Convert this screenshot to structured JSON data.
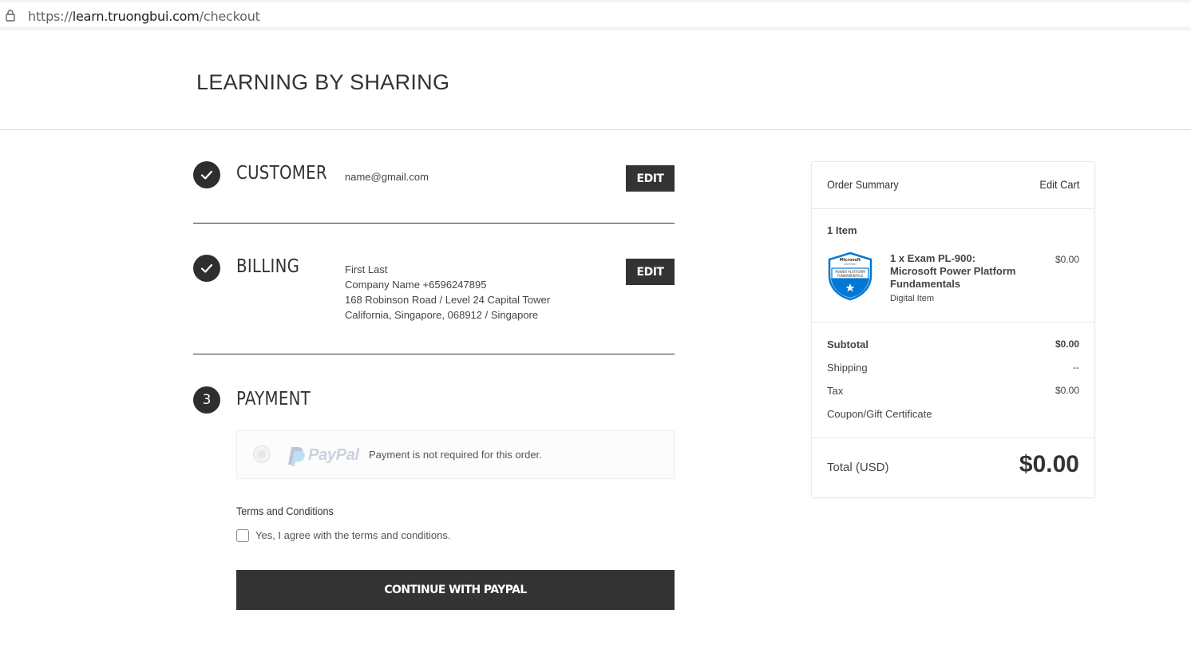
{
  "browser": {
    "url_scheme": "https://",
    "url_host": "learn.truongbui.com",
    "url_path": "/checkout"
  },
  "header": {
    "store_name": "LEARNING BY SHARING"
  },
  "customer": {
    "title": "CUSTOMER",
    "email": "name@gmail.com",
    "edit_label": "EDIT"
  },
  "billing": {
    "title": "BILLING",
    "lines": [
      "First Last",
      "Company Name +6596247895",
      "168 Robinson Road / Level 24 Capital Tower",
      "California, Singapore, 068912 / Singapore"
    ],
    "edit_label": "EDIT"
  },
  "payment": {
    "step_number": "3",
    "title": "PAYMENT",
    "provider": "PayPal",
    "message": "Payment is not required for this order.",
    "terms_title": "Terms and Conditions",
    "terms_label": "Yes, I agree with the terms and conditions.",
    "terms_checked": false,
    "continue_label": "CONTINUE WITH PAYPAL"
  },
  "summary": {
    "title": "Order Summary",
    "edit_cart_label": "Edit Cart",
    "item_count": "1 Item",
    "item": {
      "name": "1 x Exam PL-900: Microsoft Power Platform Fundamentals",
      "type": "Digital Item",
      "price": "$0.00",
      "badge_top": "Microsoft",
      "badge_sub": "CERTIFIED",
      "badge_line1": "POWER PLATFORM",
      "badge_line2": "FUNDAMENTALS"
    },
    "rows": [
      {
        "label": "Subtotal",
        "value": "$0.00"
      },
      {
        "label": "Shipping",
        "value": "--"
      },
      {
        "label": "Tax",
        "value": "$0.00"
      },
      {
        "label": "Coupon/Gift Certificate",
        "value": ""
      }
    ],
    "total_label": "Total (USD)",
    "total_value": "$0.00"
  },
  "colors": {
    "primary_dark": "#333333",
    "badge_blue": "#0078d4"
  }
}
